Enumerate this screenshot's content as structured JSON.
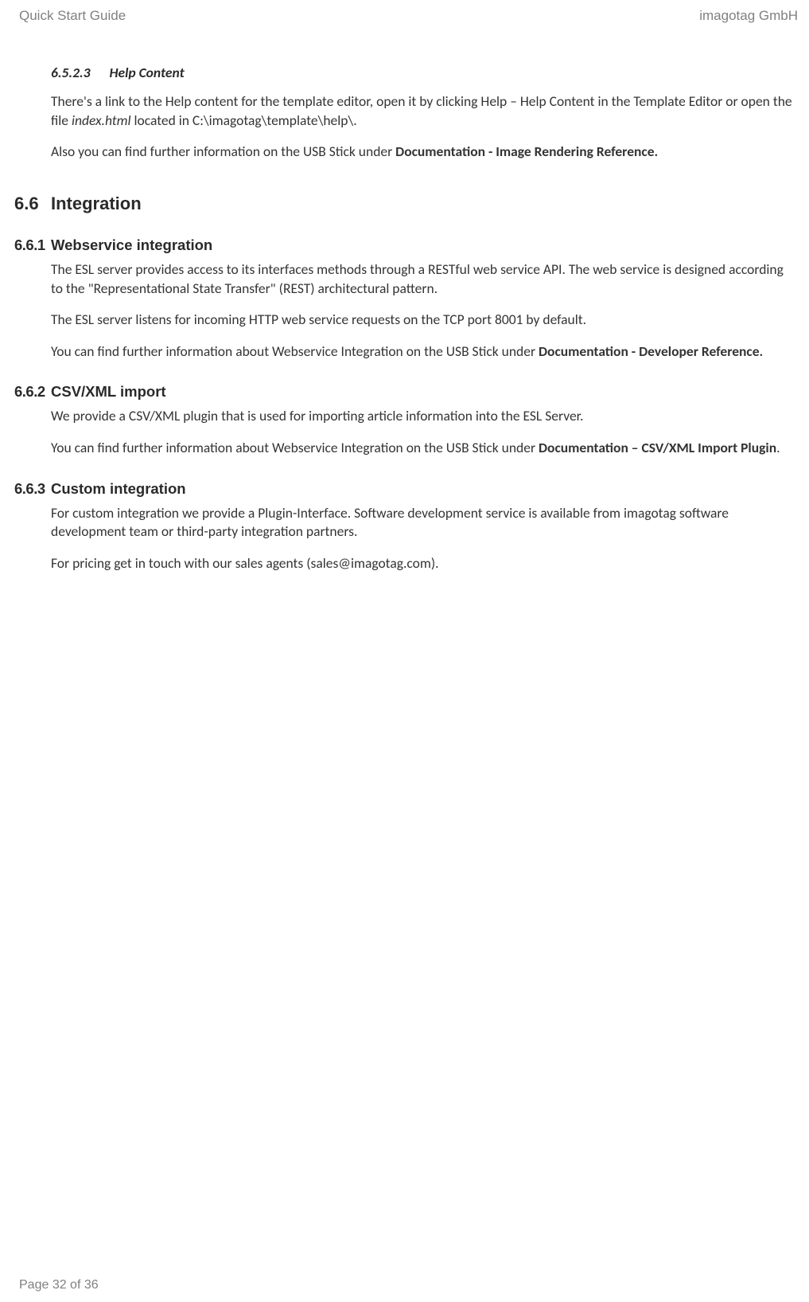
{
  "header": {
    "left": "Quick Start Guide",
    "right": "imagotag GmbH"
  },
  "s6523": {
    "num": "6.5.2.3",
    "title": "Help Content",
    "p1_a": "There's a link to the Help content for the template editor, open it by clicking Help – Help Content in the Template Editor or open the file ",
    "p1_i": "index.html",
    "p1_b": " located in C:\\imagotag\\template\\help\\.",
    "p2_a": "Also you can find further information on the USB Stick under ",
    "p2_bold": "Documentation - Image Rendering Reference."
  },
  "s66": {
    "num": "6.6",
    "title": "Integration"
  },
  "s661": {
    "num": "6.6.1",
    "title": "Webservice integration",
    "p1": "The ESL server provides access to its interfaces methods through a RESTful web service API. The web service is designed according to the \"Representational State Transfer\" (REST) architectural pattern.",
    "p2": "The ESL server listens for incoming HTTP web service requests on the TCP port 8001 by default.",
    "p3_a": "You can find further information about Webservice Integration on the USB Stick under ",
    "p3_bold": "Documentation - Developer Reference."
  },
  "s662": {
    "num": "6.6.2",
    "title": "CSV/XML import",
    "p1": "We provide a CSV/XML plugin that is used for importing article information into the ESL Server.",
    "p2_a": "You can find further information about Webservice Integration on the USB Stick under ",
    "p2_bold": "Documentation – CSV/XML Import Plugin",
    "p2_c": "."
  },
  "s663": {
    "num": "6.6.3",
    "title": "Custom integration",
    "p1": "For custom integration we provide a Plugin-Interface. Software development service is available from imagotag software development team or third-party integration partners.",
    "p2": "For pricing get in touch with our sales agents (sales@imagotag.com)."
  },
  "footer": "Page 32 of 36"
}
